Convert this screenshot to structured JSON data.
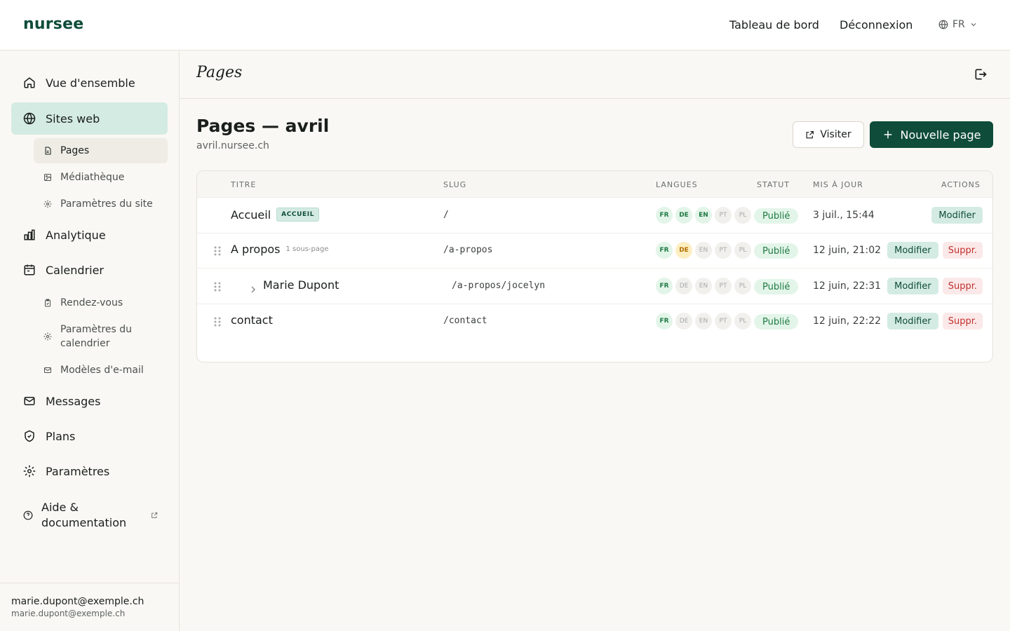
{
  "brand": "nursee",
  "topnav": {
    "dashboard": "Tableau de bord",
    "logout": "Déconnexion",
    "lang": "FR"
  },
  "sidebar": {
    "overview": "Vue d'ensemble",
    "websites": "Sites web",
    "websites_sub": [
      "Pages",
      "Médiathèque",
      "Paramètres du site"
    ],
    "analytics": "Analytique",
    "calendar": "Calendrier",
    "calendar_sub": [
      "Rendez-vous",
      "Paramètres du calendrier",
      "Modèles d'e-mail"
    ],
    "messages": "Messages",
    "plans": "Plans",
    "settings": "Paramètres",
    "help": "Aide & documentation"
  },
  "user": {
    "name": "marie.dupont@exemple.ch",
    "email": "marie.dupont@exemple.ch"
  },
  "header": {
    "title": "Pages"
  },
  "main": {
    "heading": "Pages — avril",
    "domain": "avril.nursee.ch",
    "visit_label": "Visiter",
    "new_page_label": "Nouvelle page"
  },
  "table": {
    "columns": {
      "title": "TITRE",
      "slug": "SLUG",
      "langs": "LANGUES",
      "status": "STATUT",
      "updated": "MIS À JOUR",
      "actions": "ACTIONS"
    },
    "home_badge": "ACCUEIL",
    "edit_label": "Modifier",
    "delete_label": "Suppr.",
    "rows": [
      {
        "title": "Accueil",
        "slug": "/",
        "langs": [
          "FR",
          "DE",
          "EN",
          "PT",
          "PL"
        ],
        "lang_states": [
          "ok",
          "ok",
          "ok",
          "off",
          "off"
        ],
        "status": "Publié",
        "updated": "3 juil., 15:44"
      },
      {
        "title": "A propos",
        "subcount": "1 sous-page",
        "slug": "/a-propos",
        "langs": [
          "FR",
          "DE",
          "EN",
          "PT",
          "PL"
        ],
        "lang_states": [
          "ok",
          "warn",
          "off",
          "off",
          "off"
        ],
        "status": "Publié",
        "updated": "12 juin, 21:02"
      },
      {
        "title": "Marie Dupont",
        "slug": "/a-propos/jocelyn",
        "langs": [
          "FR",
          "DE",
          "EN",
          "PT",
          "PL"
        ],
        "lang_states": [
          "ok",
          "off",
          "off",
          "off",
          "off"
        ],
        "status": "Publié",
        "updated": "12 juin, 22:31"
      },
      {
        "title": "contact",
        "slug": "/contact",
        "langs": [
          "FR",
          "DE",
          "EN",
          "PT",
          "PL"
        ],
        "lang_states": [
          "ok",
          "off",
          "off",
          "off",
          "off"
        ],
        "status": "Publié",
        "updated": "12 juin, 22:22"
      }
    ]
  },
  "colors": {
    "brand": "#0f4c3a",
    "accent_soft": "#d4ebe3",
    "published": "#1f7a43",
    "delete": "#c0302e"
  }
}
